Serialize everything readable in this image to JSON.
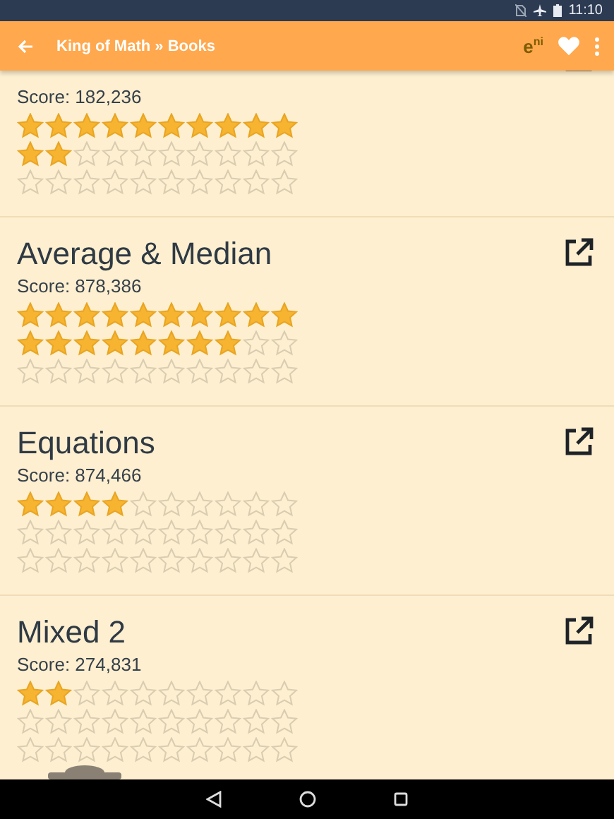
{
  "status_bar": {
    "time": "11:10"
  },
  "app_bar": {
    "title": "King of Math » Books",
    "badge": "e$^{ni}$"
  },
  "books": [
    {
      "score": "Score: 182,236",
      "rows": [
        {
          "stars": 10
        },
        {
          "stars": 2
        },
        {
          "stars": 0
        }
      ]
    },
    {
      "title": "Average & Median",
      "score": "Score: 878,386",
      "rows": [
        {
          "stars": 10
        },
        {
          "stars": 8
        },
        {
          "stars": 0
        }
      ]
    },
    {
      "title": "Equations",
      "score": "Score: 874,466",
      "rows": [
        {
          "stars": 4
        },
        {
          "stars": 0
        },
        {
          "stars": 0
        }
      ]
    },
    {
      "title": "Mixed 2",
      "score": "Score: 274,831",
      "rows": [
        {
          "stars": 2
        },
        {
          "stars": 0
        },
        {
          "stars": 0
        }
      ]
    }
  ]
}
